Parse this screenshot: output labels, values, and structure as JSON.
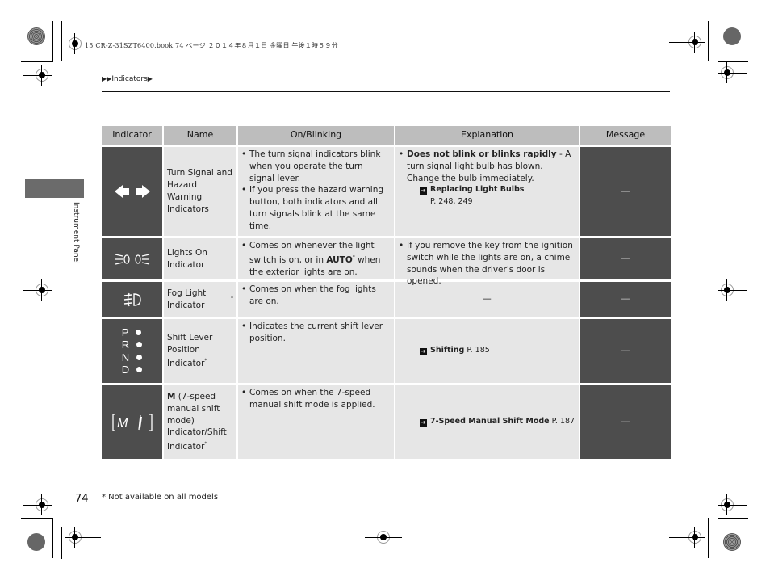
{
  "header": {
    "book_info": "15 CR-Z-31SZT6400.book  74 ページ  ２０１４年８月１日  金曜日  午後１時５９分",
    "breadcrumb_prefix": "▶▶",
    "breadcrumb_section": "Indicators",
    "breadcrumb_suffix": "▶"
  },
  "side_tab": {
    "label": "Instrument Panel"
  },
  "table": {
    "headers": [
      "Indicator",
      "Name",
      "On/Blinking",
      "Explanation",
      "Message"
    ],
    "rows": [
      {
        "icon": "turn-signal-arrows-icon",
        "name": "Turn Signal and Hazard Warning Indicators",
        "on_blinking": [
          "The turn signal indicators blink when you operate the turn signal lever.",
          "If you press the hazard warning button, both indicators and all turn signals blink at the same time."
        ],
        "explanation_bold": "Does not blink or blinks rapidly",
        "explanation_text": " - A turn signal light bulb has blown. Change the bulb immediately.",
        "ref_title": "Replacing Light Bulbs",
        "ref_pages": "P. 248, 249",
        "message": "—"
      },
      {
        "icon": "lights-on-icon",
        "name": "Lights On Indicator",
        "on_blinking_pre": "Comes on whenever the light switch is on, or in ",
        "on_blinking_bold": "AUTO",
        "on_blinking_star": "*",
        "on_blinking_post": " when the exterior lights are on.",
        "explanation": "If you remove the key from the ignition switch while the lights are on, a chime sounds when the driver's door is opened.",
        "message": "—"
      },
      {
        "icon": "fog-light-icon",
        "name": "Fog Light Indicator",
        "name_star": "*",
        "on_blinking": [
          "Comes on when the fog lights are on."
        ],
        "explanation": "—",
        "message": "—"
      },
      {
        "icon": "shift-position-icon",
        "positions": [
          "P",
          "R",
          "N",
          "D"
        ],
        "name": "Shift Lever Position Indicator",
        "name_star": "*",
        "on_blinking": [
          "Indicates the current shift lever position."
        ],
        "ref_title": "Shifting",
        "ref_pages": "P. 185",
        "message": "—"
      },
      {
        "icon": "manual-shift-mode-icon",
        "icon_letter": "M",
        "name_bold": "M",
        "name": " (7-speed manual shift mode) Indicator/Shift Indicator",
        "name_star": "*",
        "on_blinking": [
          "Comes on when the 7-speed manual shift mode is applied."
        ],
        "ref_title": "7-Speed Manual Shift Mode",
        "ref_pages": "P. 187",
        "message": "—"
      }
    ]
  },
  "footer": {
    "page_number": "74",
    "footnote": "* Not available on all models"
  }
}
